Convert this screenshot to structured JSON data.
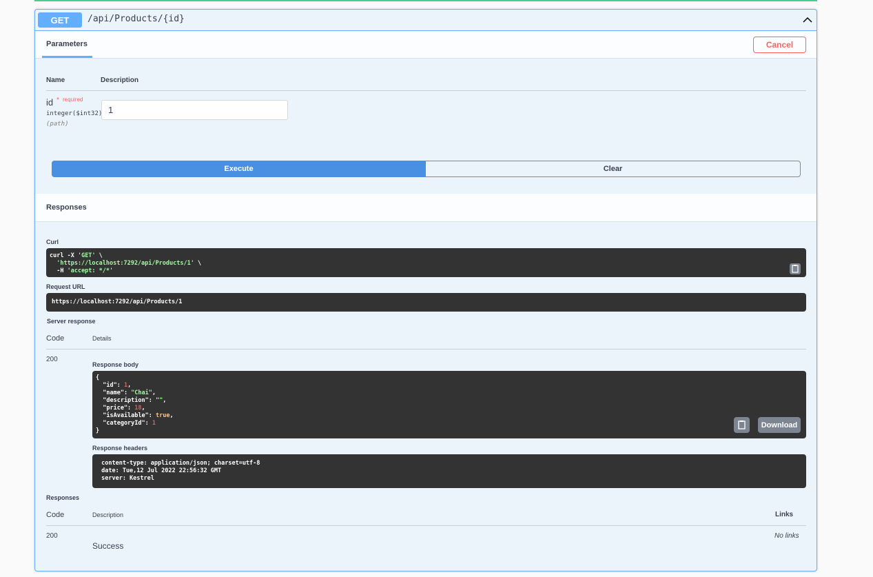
{
  "endpoint": {
    "method": "GET",
    "path": "/api/Products/{id}"
  },
  "parameters": {
    "tab_label": "Parameters",
    "cancel_label": "Cancel",
    "col_name": "Name",
    "col_description": "Description",
    "param": {
      "name": "id",
      "required_star": "*",
      "required_label": "required",
      "type": "integer($int32)",
      "in": "(path)",
      "value": "1"
    },
    "execute_label": "Execute",
    "clear_label": "Clear"
  },
  "responses_header": "Responses",
  "curl": {
    "label": "Curl",
    "line1_pre": "curl -X ",
    "line1_str": "'GET'",
    "line1_post": " \\",
    "line2_str": "  'https://localhost:7292/api/Products/1'",
    "line2_post": " \\",
    "line3_pre": "  -H ",
    "line3_str": "'accept: */*'"
  },
  "request_url": {
    "label": "Request URL",
    "value": "https://localhost:7292/api/Products/1"
  },
  "server_response": {
    "label": "Server response",
    "col_code": "Code",
    "col_details": "Details",
    "code": "200",
    "body_label": "Response body",
    "body": {
      "open": "{",
      "k_id": "  \"id\": ",
      "v_id": "1",
      "k_name": "  \"name\": ",
      "v_name": "\"Chai\"",
      "k_description": "  \"description\": ",
      "v_description": "\"\"",
      "k_price": "  \"price\": ",
      "v_price": "18",
      "k_isAvailable": "  \"isAvailable\": ",
      "v_isAvailable": "true",
      "k_categoryId": "  \"categoryId\": ",
      "v_categoryId": "1",
      "close": "}"
    },
    "download_label": "Download",
    "headers_label": "Response headers",
    "headers": [
      " content-type: application/json; charset=utf-8",
      " date: Tue,12 Jul 2022 22:56:32 GMT",
      " server: Kestrel"
    ]
  },
  "responses_table": {
    "label": "Responses",
    "col_code": "Code",
    "col_description": "Description",
    "col_links": "Links",
    "rows": [
      {
        "code": "200",
        "description": "Success",
        "links": "No links"
      }
    ]
  },
  "colors": {
    "get_blue": "#61affe",
    "execute_blue": "#4990e2",
    "cancel_red": "#ff6060",
    "code_bg": "#333333"
  }
}
